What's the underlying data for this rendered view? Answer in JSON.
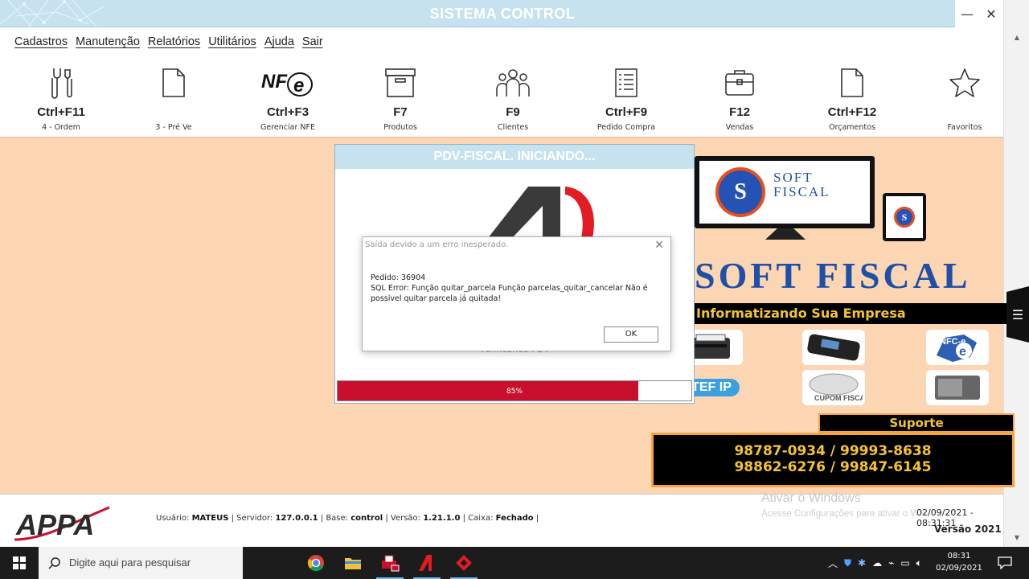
{
  "window": {
    "title": "SISTEMA CONTROL",
    "minimize_glyph": "—",
    "close_glyph": "✕"
  },
  "menu": [
    {
      "label": "Cadastros"
    },
    {
      "label": "Manutenção"
    },
    {
      "label": "Relatórios"
    },
    {
      "label": "Utilitários"
    },
    {
      "label": "Ajuda"
    },
    {
      "label": "Sair"
    }
  ],
  "toolbar": [
    {
      "icon": "tools-icon",
      "key": "Ctrl+F11",
      "label": "4 - Ordem"
    },
    {
      "icon": "document-icon",
      "key": "",
      "label": "3 - Pré Ve"
    },
    {
      "icon": "nfe-icon",
      "key": "Ctrl+F3",
      "label": "Gerenciar NFE"
    },
    {
      "icon": "box-icon",
      "key": "F7",
      "label": "Produtos"
    },
    {
      "icon": "group-icon",
      "key": "F9",
      "label": "Clientes"
    },
    {
      "icon": "list-icon",
      "key": "Ctrl+F9",
      "label": "Pedido Compra"
    },
    {
      "icon": "briefcase-icon",
      "key": "F12",
      "label": "Vendas"
    },
    {
      "icon": "document-icon",
      "key": "Ctrl+F12",
      "label": "Orçamentos"
    },
    {
      "icon": "star-icon",
      "key": "",
      "label": "Favoritos"
    }
  ],
  "splash": {
    "title": "PDV-FISCAL. INICIANDO...",
    "status": "Verificando PDV",
    "progress": 0.85,
    "progress_label": "85%",
    "progress_color": "#c8102e"
  },
  "error_dialog": {
    "title": "Saída devido a um erro inesperado.",
    "line1": "Pedido: 36904",
    "line2": "SQL Error: Função quitar_parcela Função parcelas_quitar_cancelar Não é possível quitar parcela já quitada!",
    "ok_label": "OK"
  },
  "ad": {
    "logo_text": "S",
    "brand_small": "SOFT\nFISCAL",
    "brand_line1": "SOFT",
    "brand_line2": "FISCAL",
    "brand_big": "SOFT FISCAL",
    "slogan": "Informatizando Sua Empresa",
    "nfce_label": "NFC-e",
    "tef_label": "TEF IP",
    "cupom_label": "CUPOM FISCAL",
    "suporte_label": "Suporte",
    "phones_line1": "98787-0934 / 99993-8638",
    "phones_line2": "98862-6276 / 99847-6145"
  },
  "statusbar": {
    "logo_text": "APPA",
    "user_label": "Usuário: ",
    "user": "MATEUS",
    "server_label": " | Servidor: ",
    "server": "127.0.0.1",
    "base_label": " | Base: ",
    "base": "control",
    "version_label": " | Versão: ",
    "version": "1.21.1.0",
    "caixa_label": " | Caixa: ",
    "caixa": "Fechado",
    "trail": " |",
    "datetime": "02/09/2021 - 08:31:31",
    "version_year": "Versão 2021",
    "activate_title": "Ativar o Windows",
    "activate_sub": "Acesse Configurações para ativar o Windows."
  },
  "taskbar": {
    "search_placeholder": "Digite aqui para pesquisar",
    "clock_time": "08:31",
    "clock_date": "02/09/2021"
  },
  "colors": {
    "titlebar": "#c6e2ef",
    "workspace": "#fcd6b3",
    "brand_blue": "#1f4fa8",
    "support_yellow": "#f4c430",
    "appa_red": "#c8102e"
  }
}
